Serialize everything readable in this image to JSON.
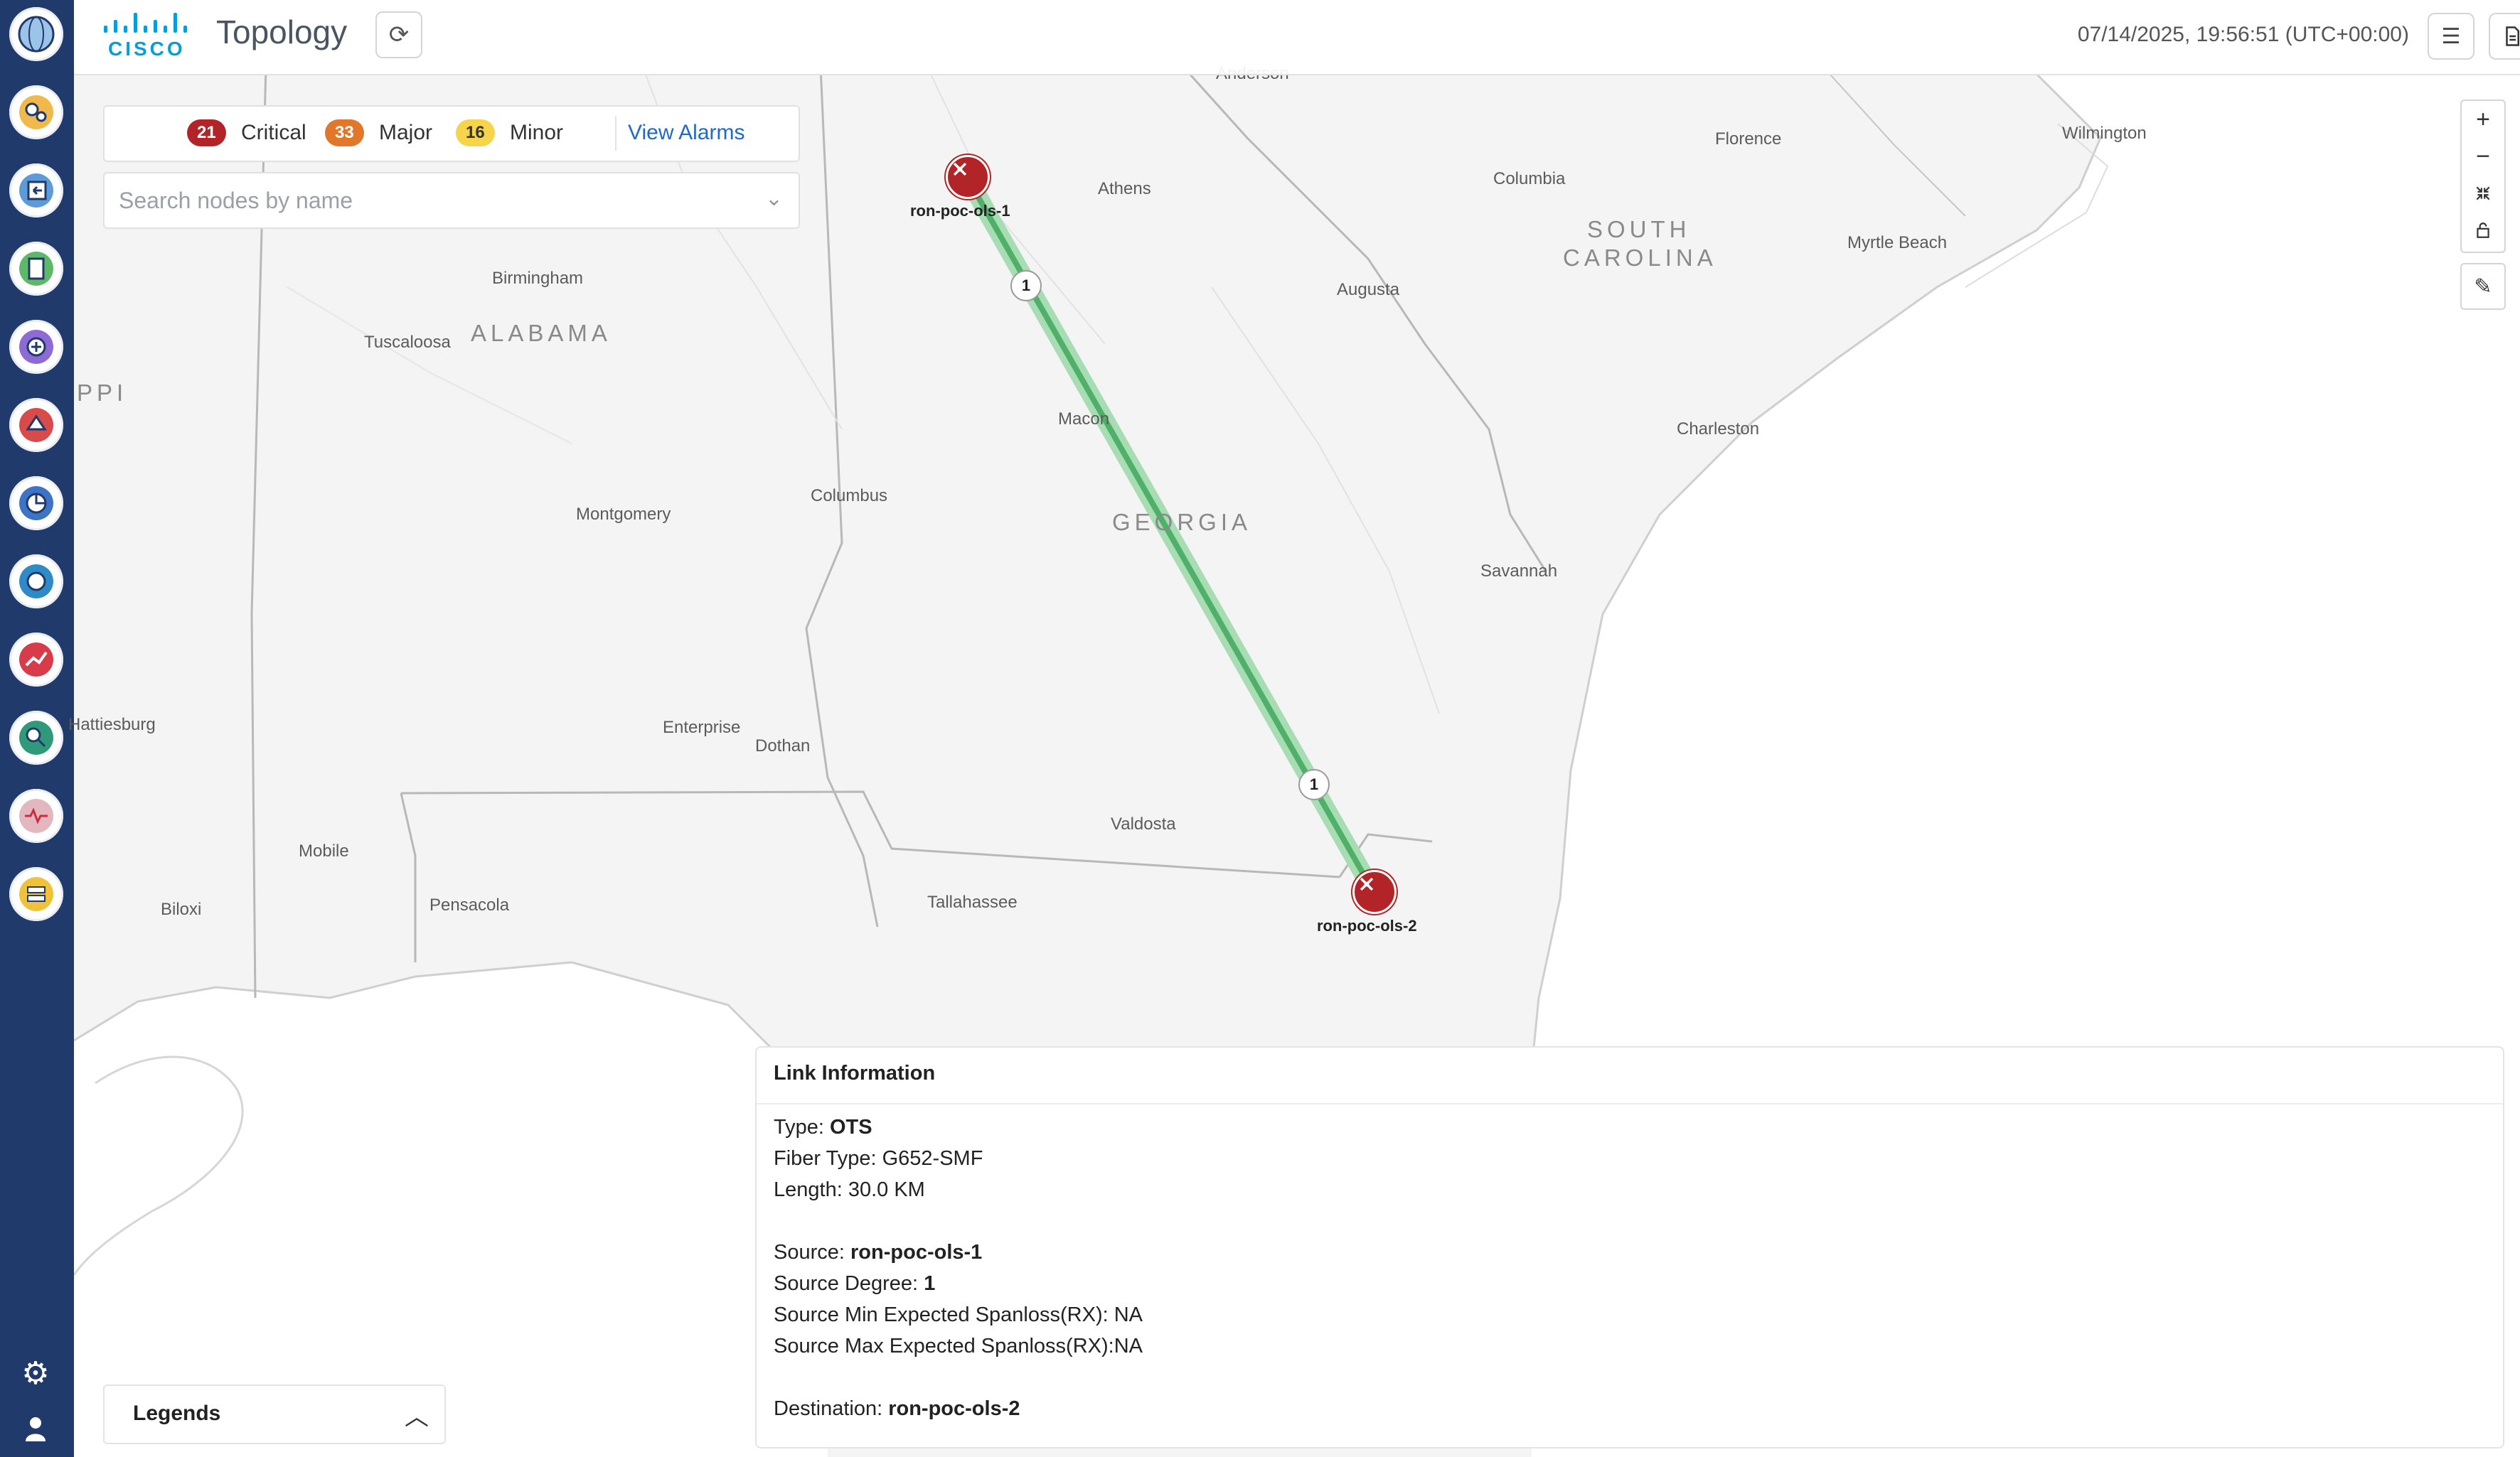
{
  "app": {
    "title": "Topology",
    "timestamp": "07/14/2025, 19:56:51 (UTC+00:00)"
  },
  "sidebar": {
    "items": [
      {
        "icon": "globe-icon"
      },
      {
        "icon": "gears-icon"
      },
      {
        "icon": "import-icon"
      },
      {
        "icon": "document-icon"
      },
      {
        "icon": "add-circle-icon"
      },
      {
        "icon": "route-icon"
      },
      {
        "icon": "chart-circle-icon"
      },
      {
        "icon": "refresh-circle-icon"
      },
      {
        "icon": "analytics-icon"
      },
      {
        "icon": "network-search-icon"
      },
      {
        "icon": "pulse-search-icon"
      },
      {
        "icon": "server-icon"
      }
    ],
    "bottom": [
      {
        "icon": "settings-icon"
      },
      {
        "icon": "user-icon"
      }
    ]
  },
  "alarms": {
    "critical_count": "21",
    "critical_label": "Critical",
    "major_count": "33",
    "major_label": "Major",
    "minor_count": "16",
    "minor_label": "Minor",
    "view_label": "View Alarms",
    "colors": {
      "critical": "#b32428",
      "major": "#e0772a",
      "minor": "#f6d54a"
    }
  },
  "search": {
    "placeholder": "Search nodes by name"
  },
  "map": {
    "states": [
      "ALABAMA",
      "GEORGIA",
      "SOUTH",
      "CAROLINA",
      "PPI"
    ],
    "cities": [
      "Anderson",
      "Florence",
      "Wilmington",
      "Athens",
      "Columbia",
      "Myrtle Beach",
      "Birmingham",
      "Augusta",
      "Tuscaloosa",
      "Charleston",
      "Macon",
      "Columbus",
      "Montgomery",
      "Savannah",
      "Hattiesburg",
      "Enterprise",
      "Dothan",
      "Valdosta",
      "Mobile",
      "Tallahassee",
      "Biloxi",
      "Pensacola"
    ],
    "nodes": [
      {
        "name": "ron-poc-ols-1",
        "status": "critical"
      },
      {
        "name": "ron-poc-ols-2",
        "status": "critical"
      }
    ],
    "link_badges": [
      "1",
      "1"
    ],
    "link_color": "#4fb06a"
  },
  "link_info": {
    "title": "Link Information",
    "type_label": "Type:",
    "type_value": "OTS",
    "fiber_type": "Fiber Type: G652-SMF",
    "length": "Length: 30.0 KM",
    "source_label": "Source:",
    "source_value": "ron-poc-ols-1",
    "source_degree_label": "Source Degree:",
    "source_degree_value": "1",
    "source_min": "Source Min Expected Spanloss(RX): NA",
    "source_max": "Source Max Expected Spanloss(RX):NA",
    "destination_label": "Destination:",
    "destination_value": "ron-poc-ols-2"
  },
  "legends": {
    "label": "Legends"
  }
}
